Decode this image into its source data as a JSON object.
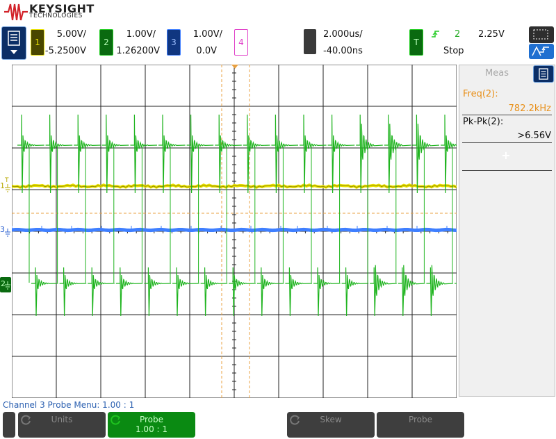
{
  "brand": {
    "name": "KEYSIGHT",
    "sub": "TECHNOLOGIES",
    "logo_color": "#d2232a"
  },
  "channels": [
    {
      "num": "1",
      "scale": "5.00V/",
      "offset": "-5.2500V",
      "color": "#e8e000",
      "bg": "#4a4700"
    },
    {
      "num": "2",
      "scale": "1.00V/",
      "offset": "1.26200V",
      "color": "#22cc22",
      "bg": "#0a6a10"
    },
    {
      "num": "3",
      "scale": "1.00V/",
      "offset": "0.0V",
      "color": "#3f7fff",
      "bg": "#103680"
    },
    {
      "num": "4",
      "color": "#e040c8"
    }
  ],
  "timebase": {
    "scale": "2.000us/",
    "delay": "-40.00ns"
  },
  "trigger": {
    "label": "T",
    "source": "2",
    "level": "2.25V",
    "status": "Stop"
  },
  "icons": {
    "menu": "menu-list-icon",
    "zoom": "zoom-box-icon",
    "trig_mode": "auto-trigger-icon"
  },
  "markers": {
    "ch1_ground": "1",
    "ch1_trig": "T",
    "ch3_ground": "3",
    "ch2_ground": "2"
  },
  "measurements": {
    "tab": "Meas",
    "items": [
      {
        "label": "Freq(2):",
        "value": "782.2kHz",
        "color": "#e8901a"
      },
      {
        "label": "Pk-Pk(2):",
        "value": ">6.56V",
        "color": "#111111"
      }
    ],
    "add_label": "+"
  },
  "probe_message": "Channel 3 Probe Menu: 1.00 : 1",
  "softkeys": [
    {
      "label": "Units",
      "value": "",
      "active": false
    },
    {
      "label": "Probe",
      "value": "1.00 : 1",
      "active": true
    },
    {
      "label": "",
      "value": "",
      "active": false
    },
    {
      "label": "Skew",
      "value": "",
      "active": false
    },
    {
      "label": "Probe",
      "value": "",
      "active": false
    }
  ]
}
